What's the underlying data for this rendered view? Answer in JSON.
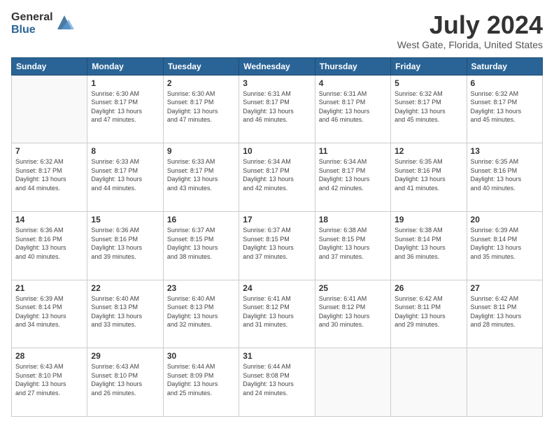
{
  "logo": {
    "general": "General",
    "blue": "Blue"
  },
  "title": "July 2024",
  "location": "West Gate, Florida, United States",
  "days_of_week": [
    "Sunday",
    "Monday",
    "Tuesday",
    "Wednesday",
    "Thursday",
    "Friday",
    "Saturday"
  ],
  "weeks": [
    [
      {
        "day": "",
        "info": ""
      },
      {
        "day": "1",
        "info": "Sunrise: 6:30 AM\nSunset: 8:17 PM\nDaylight: 13 hours\nand 47 minutes."
      },
      {
        "day": "2",
        "info": "Sunrise: 6:30 AM\nSunset: 8:17 PM\nDaylight: 13 hours\nand 47 minutes."
      },
      {
        "day": "3",
        "info": "Sunrise: 6:31 AM\nSunset: 8:17 PM\nDaylight: 13 hours\nand 46 minutes."
      },
      {
        "day": "4",
        "info": "Sunrise: 6:31 AM\nSunset: 8:17 PM\nDaylight: 13 hours\nand 46 minutes."
      },
      {
        "day": "5",
        "info": "Sunrise: 6:32 AM\nSunset: 8:17 PM\nDaylight: 13 hours\nand 45 minutes."
      },
      {
        "day": "6",
        "info": "Sunrise: 6:32 AM\nSunset: 8:17 PM\nDaylight: 13 hours\nand 45 minutes."
      }
    ],
    [
      {
        "day": "7",
        "info": "Sunrise: 6:32 AM\nSunset: 8:17 PM\nDaylight: 13 hours\nand 44 minutes."
      },
      {
        "day": "8",
        "info": "Sunrise: 6:33 AM\nSunset: 8:17 PM\nDaylight: 13 hours\nand 44 minutes."
      },
      {
        "day": "9",
        "info": "Sunrise: 6:33 AM\nSunset: 8:17 PM\nDaylight: 13 hours\nand 43 minutes."
      },
      {
        "day": "10",
        "info": "Sunrise: 6:34 AM\nSunset: 8:17 PM\nDaylight: 13 hours\nand 42 minutes."
      },
      {
        "day": "11",
        "info": "Sunrise: 6:34 AM\nSunset: 8:17 PM\nDaylight: 13 hours\nand 42 minutes."
      },
      {
        "day": "12",
        "info": "Sunrise: 6:35 AM\nSunset: 8:16 PM\nDaylight: 13 hours\nand 41 minutes."
      },
      {
        "day": "13",
        "info": "Sunrise: 6:35 AM\nSunset: 8:16 PM\nDaylight: 13 hours\nand 40 minutes."
      }
    ],
    [
      {
        "day": "14",
        "info": "Sunrise: 6:36 AM\nSunset: 8:16 PM\nDaylight: 13 hours\nand 40 minutes."
      },
      {
        "day": "15",
        "info": "Sunrise: 6:36 AM\nSunset: 8:16 PM\nDaylight: 13 hours\nand 39 minutes."
      },
      {
        "day": "16",
        "info": "Sunrise: 6:37 AM\nSunset: 8:15 PM\nDaylight: 13 hours\nand 38 minutes."
      },
      {
        "day": "17",
        "info": "Sunrise: 6:37 AM\nSunset: 8:15 PM\nDaylight: 13 hours\nand 37 minutes."
      },
      {
        "day": "18",
        "info": "Sunrise: 6:38 AM\nSunset: 8:15 PM\nDaylight: 13 hours\nand 37 minutes."
      },
      {
        "day": "19",
        "info": "Sunrise: 6:38 AM\nSunset: 8:14 PM\nDaylight: 13 hours\nand 36 minutes."
      },
      {
        "day": "20",
        "info": "Sunrise: 6:39 AM\nSunset: 8:14 PM\nDaylight: 13 hours\nand 35 minutes."
      }
    ],
    [
      {
        "day": "21",
        "info": "Sunrise: 6:39 AM\nSunset: 8:14 PM\nDaylight: 13 hours\nand 34 minutes."
      },
      {
        "day": "22",
        "info": "Sunrise: 6:40 AM\nSunset: 8:13 PM\nDaylight: 13 hours\nand 33 minutes."
      },
      {
        "day": "23",
        "info": "Sunrise: 6:40 AM\nSunset: 8:13 PM\nDaylight: 13 hours\nand 32 minutes."
      },
      {
        "day": "24",
        "info": "Sunrise: 6:41 AM\nSunset: 8:12 PM\nDaylight: 13 hours\nand 31 minutes."
      },
      {
        "day": "25",
        "info": "Sunrise: 6:41 AM\nSunset: 8:12 PM\nDaylight: 13 hours\nand 30 minutes."
      },
      {
        "day": "26",
        "info": "Sunrise: 6:42 AM\nSunset: 8:11 PM\nDaylight: 13 hours\nand 29 minutes."
      },
      {
        "day": "27",
        "info": "Sunrise: 6:42 AM\nSunset: 8:11 PM\nDaylight: 13 hours\nand 28 minutes."
      }
    ],
    [
      {
        "day": "28",
        "info": "Sunrise: 6:43 AM\nSunset: 8:10 PM\nDaylight: 13 hours\nand 27 minutes."
      },
      {
        "day": "29",
        "info": "Sunrise: 6:43 AM\nSunset: 8:10 PM\nDaylight: 13 hours\nand 26 minutes."
      },
      {
        "day": "30",
        "info": "Sunrise: 6:44 AM\nSunset: 8:09 PM\nDaylight: 13 hours\nand 25 minutes."
      },
      {
        "day": "31",
        "info": "Sunrise: 6:44 AM\nSunset: 8:08 PM\nDaylight: 13 hours\nand 24 minutes."
      },
      {
        "day": "",
        "info": ""
      },
      {
        "day": "",
        "info": ""
      },
      {
        "day": "",
        "info": ""
      }
    ]
  ]
}
